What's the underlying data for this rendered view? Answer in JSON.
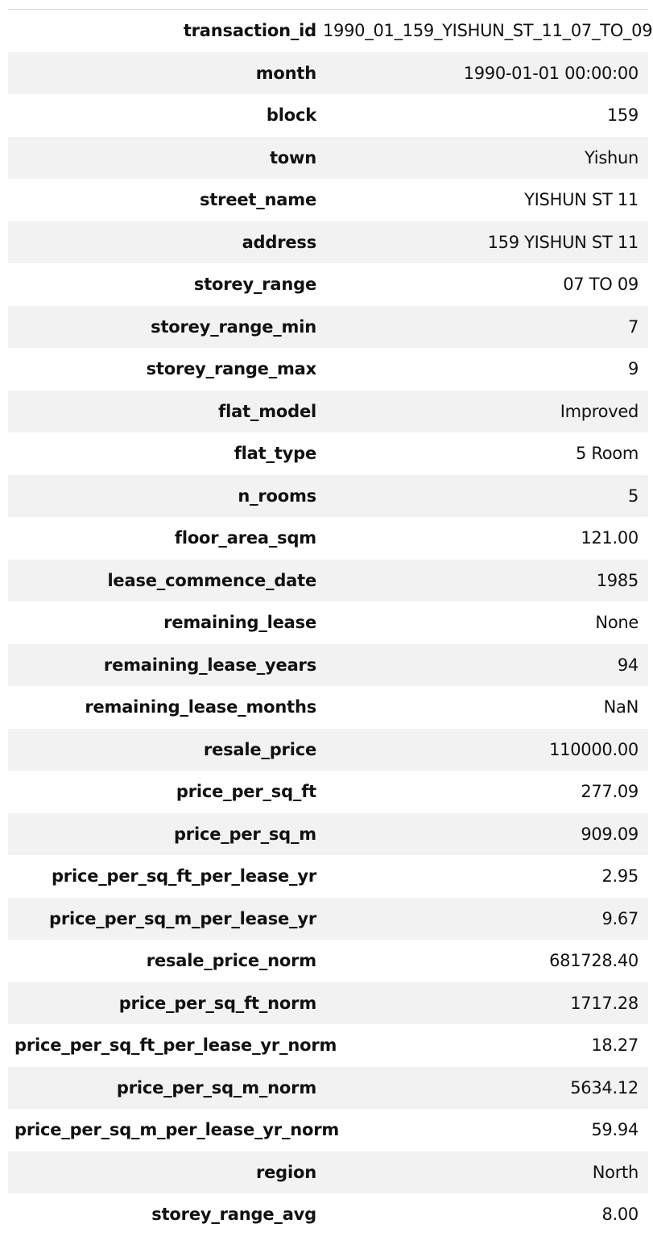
{
  "record": {
    "rows": [
      {
        "key": "transaction_id",
        "value": "1990_01_159_YISHUN_ST_11_07_TO_09"
      },
      {
        "key": "month",
        "value": "1990-01-01 00:00:00"
      },
      {
        "key": "block",
        "value": "159"
      },
      {
        "key": "town",
        "value": "Yishun"
      },
      {
        "key": "street_name",
        "value": "YISHUN ST 11"
      },
      {
        "key": "address",
        "value": "159 YISHUN ST 11"
      },
      {
        "key": "storey_range",
        "value": "07 TO 09"
      },
      {
        "key": "storey_range_min",
        "value": "7"
      },
      {
        "key": "storey_range_max",
        "value": "9"
      },
      {
        "key": "flat_model",
        "value": "Improved"
      },
      {
        "key": "flat_type",
        "value": "5 Room"
      },
      {
        "key": "n_rooms",
        "value": "5"
      },
      {
        "key": "floor_area_sqm",
        "value": "121.00"
      },
      {
        "key": "lease_commence_date",
        "value": "1985"
      },
      {
        "key": "remaining_lease",
        "value": "None"
      },
      {
        "key": "remaining_lease_years",
        "value": "94"
      },
      {
        "key": "remaining_lease_months",
        "value": "NaN"
      },
      {
        "key": "resale_price",
        "value": "110000.00"
      },
      {
        "key": "price_per_sq_ft",
        "value": "277.09"
      },
      {
        "key": "price_per_sq_m",
        "value": "909.09"
      },
      {
        "key": "price_per_sq_ft_per_lease_yr",
        "value": "2.95"
      },
      {
        "key": "price_per_sq_m_per_lease_yr",
        "value": "9.67"
      },
      {
        "key": "resale_price_norm",
        "value": "681728.40"
      },
      {
        "key": "price_per_sq_ft_norm",
        "value": "1717.28"
      },
      {
        "key": "price_per_sq_ft_per_lease_yr_norm",
        "value": "18.27"
      },
      {
        "key": "price_per_sq_m_norm",
        "value": "5634.12"
      },
      {
        "key": "price_per_sq_m_per_lease_yr_norm",
        "value": "59.94"
      },
      {
        "key": "region",
        "value": "North"
      },
      {
        "key": "storey_range_avg",
        "value": "8.00"
      }
    ]
  },
  "colors": {
    "stripe": "#f2f2f2",
    "rule": "#cfcfcf",
    "text": "#111111"
  }
}
